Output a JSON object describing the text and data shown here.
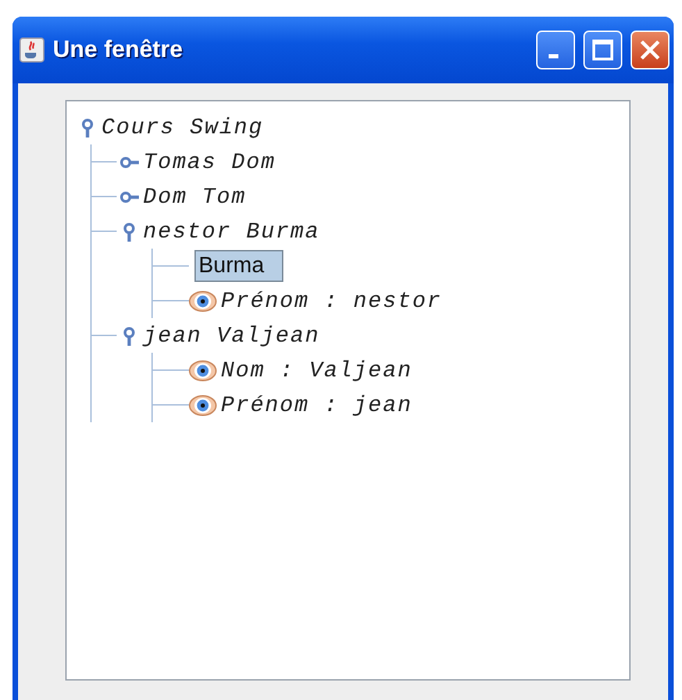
{
  "window": {
    "title": "Une fenêtre"
  },
  "tree": {
    "label": "Cours Swing",
    "expanded": true,
    "children": [
      {
        "label": "Tomas Dom",
        "expanded": false
      },
      {
        "label": "Dom Tom",
        "expanded": false
      },
      {
        "label": "nestor Burma",
        "expanded": true,
        "children": [
          {
            "label": "Burma",
            "editing": true
          },
          {
            "label": "Prénom : nestor",
            "editing": false
          }
        ]
      },
      {
        "label": "jean Valjean",
        "expanded": true,
        "children": [
          {
            "label": "Nom : Valjean",
            "editing": false
          },
          {
            "label": "Prénom : jean",
            "editing": false
          }
        ]
      }
    ]
  }
}
